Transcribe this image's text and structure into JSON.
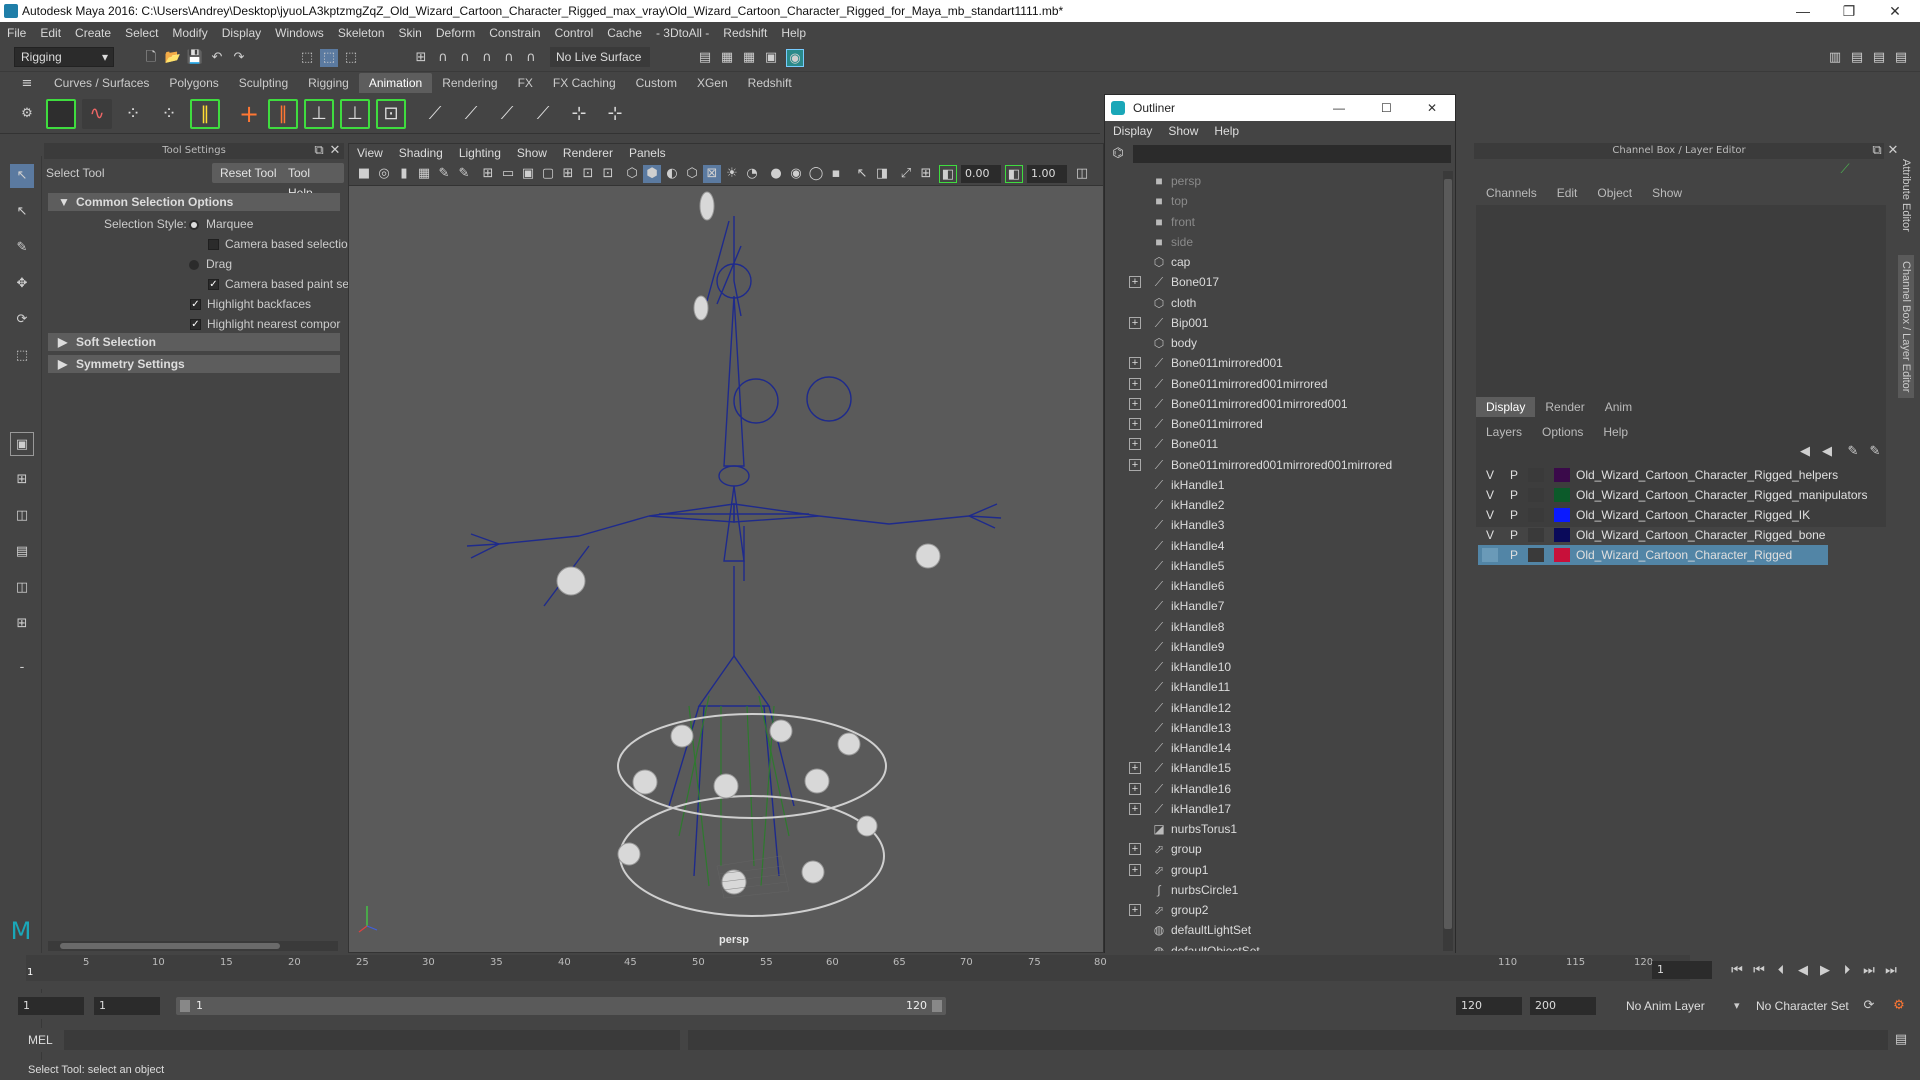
{
  "window": {
    "title": "Autodesk Maya 2016: C:\\Users\\Andrey\\Desktop\\jyuoLA3kptzmgZqZ_Old_Wizard_Cartoon_Character_Rigged_max_vray\\Old_Wizard_Cartoon_Character_Rigged_for_Maya_mb_standart1111.mb*",
    "minimize": "—",
    "restore": "❐",
    "close": "✕"
  },
  "menubar": [
    "File",
    "Edit",
    "Create",
    "Select",
    "Modify",
    "Display",
    "Windows",
    "Skeleton",
    "Skin",
    "Deform",
    "Constrain",
    "Control",
    "Cache",
    "- 3DtoAll -",
    "Redshift",
    "Help"
  ],
  "toolbar": {
    "menuset": "Rigging",
    "live_surface": "No Live Surface"
  },
  "shelf_tabs": [
    "Curves / Surfaces",
    "Polygons",
    "Sculpting",
    "Rigging",
    "Animation",
    "Rendering",
    "FX",
    "FX Caching",
    "Custom",
    "XGen",
    "Redshift"
  ],
  "shelf_active_tab": "Animation",
  "tool_settings": {
    "header": "Tool Settings",
    "tool_name": "Select Tool",
    "reset_button": "Reset Tool",
    "help_button": "Tool Help",
    "section_common": "Common Selection Options",
    "selection_style_label": "Selection Style:",
    "marquee": "Marquee",
    "camera_based_selection": "Camera based selectio",
    "drag": "Drag",
    "camera_based_paint": "Camera based paint se",
    "highlight_backfaces": "Highlight backfaces",
    "highlight_nearest": "Highlight nearest compor",
    "section_soft": "Soft Selection",
    "section_symmetry": "Symmetry Settings"
  },
  "viewport": {
    "menu": [
      "View",
      "Shading",
      "Lighting",
      "Show",
      "Renderer",
      "Panels"
    ],
    "field1": "0.00",
    "field2": "1.00",
    "camera_label": "persp"
  },
  "outliner": {
    "title": "Outliner",
    "menu": [
      "Display",
      "Show",
      "Help"
    ],
    "items": [
      {
        "label": "persp",
        "icon": "camera-icon",
        "expandable": false,
        "dim": true
      },
      {
        "label": "top",
        "icon": "camera-icon",
        "expandable": false,
        "dim": true
      },
      {
        "label": "front",
        "icon": "camera-icon",
        "expandable": false,
        "dim": true
      },
      {
        "label": "side",
        "icon": "camera-icon",
        "expandable": false,
        "dim": true
      },
      {
        "label": "cap",
        "icon": "mesh-icon",
        "expandable": false,
        "dim": false
      },
      {
        "label": "Bone017",
        "icon": "joint-icon",
        "expandable": true,
        "dim": false
      },
      {
        "label": "cloth",
        "icon": "mesh-icon",
        "expandable": false,
        "dim": false
      },
      {
        "label": "Bip001",
        "icon": "joint-icon",
        "expandable": true,
        "dim": false
      },
      {
        "label": "body",
        "icon": "mesh-icon",
        "expandable": false,
        "dim": false
      },
      {
        "label": "Bone011mirrored001",
        "icon": "joint-icon",
        "expandable": true,
        "dim": false
      },
      {
        "label": "Bone011mirrored001mirrored",
        "icon": "joint-icon",
        "expandable": true,
        "dim": false
      },
      {
        "label": "Bone011mirrored001mirrored001",
        "icon": "joint-icon",
        "expandable": true,
        "dim": false
      },
      {
        "label": "Bone011mirrored",
        "icon": "joint-icon",
        "expandable": true,
        "dim": false
      },
      {
        "label": "Bone011",
        "icon": "joint-icon",
        "expandable": true,
        "dim": false
      },
      {
        "label": "Bone011mirrored001mirrored001mirrored",
        "icon": "joint-icon",
        "expandable": true,
        "dim": false
      },
      {
        "label": "ikHandle1",
        "icon": "ikhandle-icon",
        "expandable": false,
        "dim": false
      },
      {
        "label": "ikHandle2",
        "icon": "ikhandle-icon",
        "expandable": false,
        "dim": false
      },
      {
        "label": "ikHandle3",
        "icon": "ikhandle-icon",
        "expandable": false,
        "dim": false
      },
      {
        "label": "ikHandle4",
        "icon": "ikhandle-icon",
        "expandable": false,
        "dim": false
      },
      {
        "label": "ikHandle5",
        "icon": "ikhandle-icon",
        "expandable": false,
        "dim": false
      },
      {
        "label": "ikHandle6",
        "icon": "ikhandle-icon",
        "expandable": false,
        "dim": false
      },
      {
        "label": "ikHandle7",
        "icon": "ikhandle-icon",
        "expandable": false,
        "dim": false
      },
      {
        "label": "ikHandle8",
        "icon": "ikhandle-icon",
        "expandable": false,
        "dim": false
      },
      {
        "label": "ikHandle9",
        "icon": "ikhandle-icon",
        "expandable": false,
        "dim": false
      },
      {
        "label": "ikHandle10",
        "icon": "ikhandle-icon",
        "expandable": false,
        "dim": false
      },
      {
        "label": "ikHandle11",
        "icon": "ikhandle-icon",
        "expandable": false,
        "dim": false
      },
      {
        "label": "ikHandle12",
        "icon": "ikhandle-icon",
        "expandable": false,
        "dim": false
      },
      {
        "label": "ikHandle13",
        "icon": "ikhandle-icon",
        "expandable": false,
        "dim": false
      },
      {
        "label": "ikHandle14",
        "icon": "ikhandle-icon",
        "expandable": false,
        "dim": false
      },
      {
        "label": "ikHandle15",
        "icon": "ikhandle-icon",
        "expandable": true,
        "dim": false
      },
      {
        "label": "ikHandle16",
        "icon": "ikhandle-icon",
        "expandable": true,
        "dim": false
      },
      {
        "label": "ikHandle17",
        "icon": "ikhandle-icon",
        "expandable": true,
        "dim": false
      },
      {
        "label": "nurbsTorus1",
        "icon": "nurbs-icon",
        "expandable": false,
        "dim": false
      },
      {
        "label": "group",
        "icon": "group-icon",
        "expandable": true,
        "dim": false
      },
      {
        "label": "group1",
        "icon": "group-icon",
        "expandable": true,
        "dim": false
      },
      {
        "label": "nurbsCircle1",
        "icon": "curve-icon",
        "expandable": false,
        "dim": false
      },
      {
        "label": "group2",
        "icon": "group-icon",
        "expandable": true,
        "dim": false
      },
      {
        "label": "defaultLightSet",
        "icon": "set-icon",
        "expandable": false,
        "dim": false
      },
      {
        "label": "defaultObjectSet",
        "icon": "set-icon",
        "expandable": false,
        "dim": false
      }
    ]
  },
  "channel_box": {
    "header": "Channel Box / Layer Editor",
    "menu": [
      "Channels",
      "Edit",
      "Object",
      "Show"
    ],
    "layer_tabs": [
      "Display",
      "Render",
      "Anim"
    ],
    "layer_menu": [
      "Layers",
      "Options",
      "Help"
    ],
    "layers": [
      {
        "v": "V",
        "p": "P",
        "color": "#3a0a4a",
        "name": "Old_Wizard_Cartoon_Character_Rigged_helpers",
        "selected": false
      },
      {
        "v": "V",
        "p": "P",
        "color": "#0c5a2a",
        "name": "Old_Wizard_Cartoon_Character_Rigged_manipulators",
        "selected": false
      },
      {
        "v": "V",
        "p": "P",
        "color": "#0a1aff",
        "name": "Old_Wizard_Cartoon_Character_Rigged_IK",
        "selected": false
      },
      {
        "v": "V",
        "p": "P",
        "color": "#0a0a5a",
        "name": "Old_Wizard_Cartoon_Character_Rigged_bone",
        "selected": false
      },
      {
        "v": "",
        "p": "P",
        "color": "#c8103a",
        "name": "Old_Wizard_Cartoon_Character_Rigged",
        "selected": true
      }
    ],
    "side_tabs": [
      "Attribute Editor",
      "Channel Box / Layer Editor"
    ]
  },
  "timeline": {
    "ticks": [
      "5",
      "10",
      "15",
      "20",
      "25",
      "30",
      "35",
      "40",
      "45",
      "50",
      "55",
      "60",
      "65",
      "70",
      "75",
      "80",
      "110",
      "115",
      "120"
    ],
    "current_frame": "1",
    "first_mark": "1"
  },
  "range": {
    "start": "1",
    "anim_start": "1",
    "range_start_label": "1",
    "range_end_label": "120",
    "end": "120",
    "anim_end": "200",
    "anim_layer": "No Anim Layer",
    "character_set": "No Character Set"
  },
  "command": {
    "mel_label": "MEL"
  },
  "helpline": "Select Tool: select an object"
}
